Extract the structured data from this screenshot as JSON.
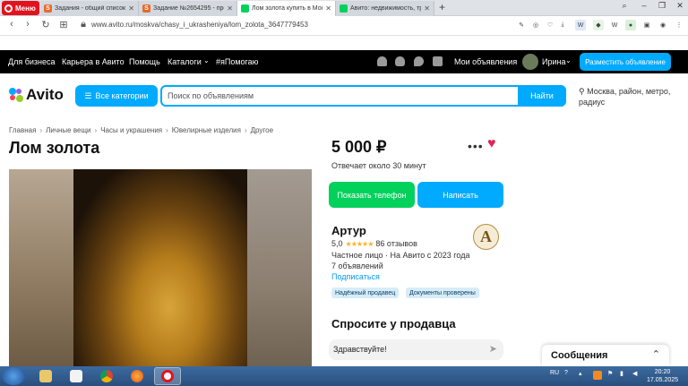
{
  "browser": {
    "menu_label": "Меню",
    "tabs": [
      {
        "title": "Задания - общий список",
        "active": false
      },
      {
        "title": "Задание №2654295 - про",
        "active": false
      },
      {
        "title": "Лом золота купить в Моск",
        "active": true
      },
      {
        "title": "Авито: недвижимость, тра",
        "active": false
      }
    ],
    "url": "www.avito.ru/moskva/chasy_i_ukrasheniya/lom_zolota_3647779453"
  },
  "topnav": {
    "links": [
      "Для бизнеса",
      "Карьера в Авито",
      "Помощь",
      "Каталоги",
      "#яПомогаю"
    ],
    "my_ads": "Мои объявления",
    "user_name": "Ирина",
    "place_ad": "Разместить объявление"
  },
  "header": {
    "logo": "Avito",
    "categories_button": "Все категории",
    "search_placeholder": "Поиск по объявлениям",
    "search_button": "Найти",
    "location": "Москва, район, метро, радиус"
  },
  "listing": {
    "breadcrumbs": [
      "Главная",
      "Личные вещи",
      "Часы и украшения",
      "Ювелирные изделия",
      "Другое"
    ],
    "title": "Лом золота",
    "price": "5 000 ₽",
    "reply_time": "Отвечает около 30 минут",
    "show_phone": "Показать телефон",
    "write": "Написать"
  },
  "seller": {
    "name": "Артур",
    "rating_value": "5,0",
    "stars": "★★★★★",
    "reviews": "86 отзывов",
    "type": "Частное лицо · На Авито с 2023 года",
    "ads_count": "7 объявлений",
    "subscribe": "Подписаться",
    "badges": [
      "Надёжный продавец",
      "Документы проверены"
    ],
    "avatar_letter": "A"
  },
  "ask": {
    "title": "Спросите у продавца",
    "message": "Здравствуйте!"
  },
  "messages_widget": {
    "label": "Сообщения"
  },
  "taskbar": {
    "lang": "RU",
    "time": "20:20",
    "date": "17.05.2025"
  },
  "colors": {
    "accent": "#00aaff",
    "green": "#02d15c",
    "heart": "#e0245e",
    "opera_red": "#e2131f"
  }
}
